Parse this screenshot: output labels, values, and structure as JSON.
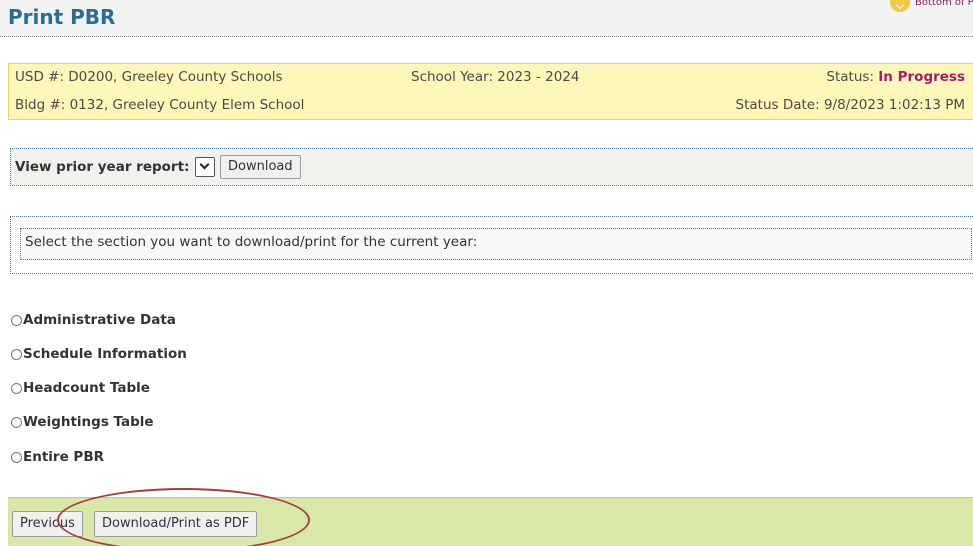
{
  "header": {
    "title": "Print PBR",
    "bottom_link": "Bottom of Pa"
  },
  "info": {
    "usd": "USD #: D0200, Greeley County Schools",
    "bldg": "Bldg #: 0132, Greeley County Elem School",
    "school_year": "School Year: 2023 - 2024",
    "status_label": "Status: ",
    "status_value": "In Progress",
    "status_date": "Status Date: 9/8/2023 1:02:13 PM",
    "status_color": "#a21d6b"
  },
  "prior_year": {
    "label": "View prior year report:",
    "download_label": "Download"
  },
  "section_prompt": "Select the section you want to download/print for the current year:",
  "sections": [
    {
      "label": "Administrative Data",
      "selected": false
    },
    {
      "label": "Schedule Information",
      "selected": false
    },
    {
      "label": "Headcount Table",
      "selected": false
    },
    {
      "label": "Weightings Table",
      "selected": false
    },
    {
      "label": "Entire PBR",
      "selected": false
    }
  ],
  "footer": {
    "previous_label": "Previous",
    "pdf_label": "Download/Print as PDF",
    "bar_color": "#d9e8a8"
  },
  "icons": {
    "bottom_link_icon": "chevron-down-icon",
    "select_icon": "chevron-down-icon"
  }
}
